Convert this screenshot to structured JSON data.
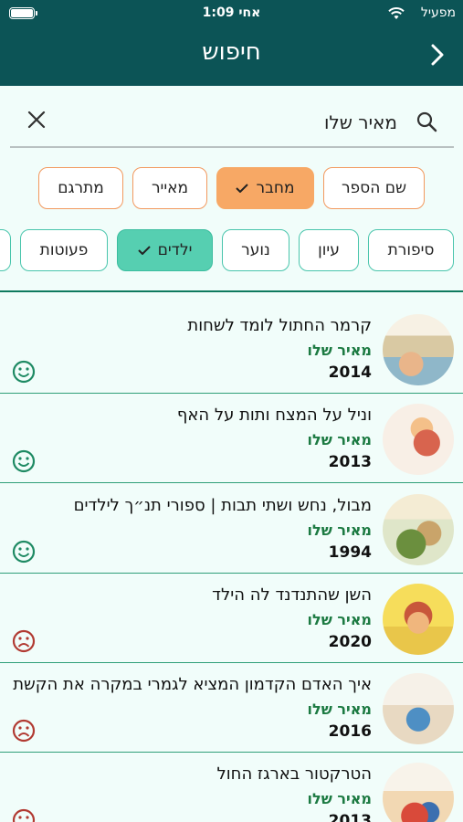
{
  "status": {
    "time": "1:09 אחי",
    "carrier": "מפעיל"
  },
  "header": {
    "title": "חיפוש",
    "back_icon": "chevron-right-icon"
  },
  "search": {
    "value": "מאיר שלו",
    "search_icon": "search-icon",
    "clear_icon": "close-icon"
  },
  "filters_row1": [
    {
      "label": "שם הספר",
      "selected": false
    },
    {
      "label": "מחבר",
      "selected": true
    },
    {
      "label": "מאייר",
      "selected": false
    },
    {
      "label": "מתרגם",
      "selected": false
    }
  ],
  "filters_row2": [
    {
      "label": "סיפורת",
      "selected": false
    },
    {
      "label": "עיון",
      "selected": false
    },
    {
      "label": "נוער",
      "selected": false
    },
    {
      "label": "ילדים",
      "selected": true
    },
    {
      "label": "פעוטות",
      "selected": false
    }
  ],
  "colors": {
    "header": "#0c5456",
    "accent_orange": "#f7a865",
    "accent_teal": "#56cfb1",
    "author_green": "#1c7a42",
    "mood_happy": "#1e8a63",
    "mood_sad": "#b13a32"
  },
  "results": [
    {
      "title": "קרמר החתול לומד לשחות",
      "author": "מאיר שלו",
      "year": "2014",
      "mood": "happy"
    },
    {
      "title": "וניל על המצח ותות על האף",
      "author": "מאיר שלו",
      "year": "2013",
      "mood": "happy"
    },
    {
      "title": "מבול, נחש ושתי תבות | ספורי תנ״ך לילדים",
      "author": "מאיר שלו",
      "year": "1994",
      "mood": "happy"
    },
    {
      "title": "השן שהתנדנד לה הילד",
      "author": "מאיר שלו",
      "year": "2020",
      "mood": "sad"
    },
    {
      "title": "איך האדם הקדמון המציא לגמרי במקרה את הקשת",
      "author": "מאיר שלו",
      "year": "2016",
      "mood": "sad"
    },
    {
      "title": "הטרקטור בארגז החול",
      "author": "מאיר שלו",
      "year": "2013",
      "mood": "sad"
    }
  ]
}
